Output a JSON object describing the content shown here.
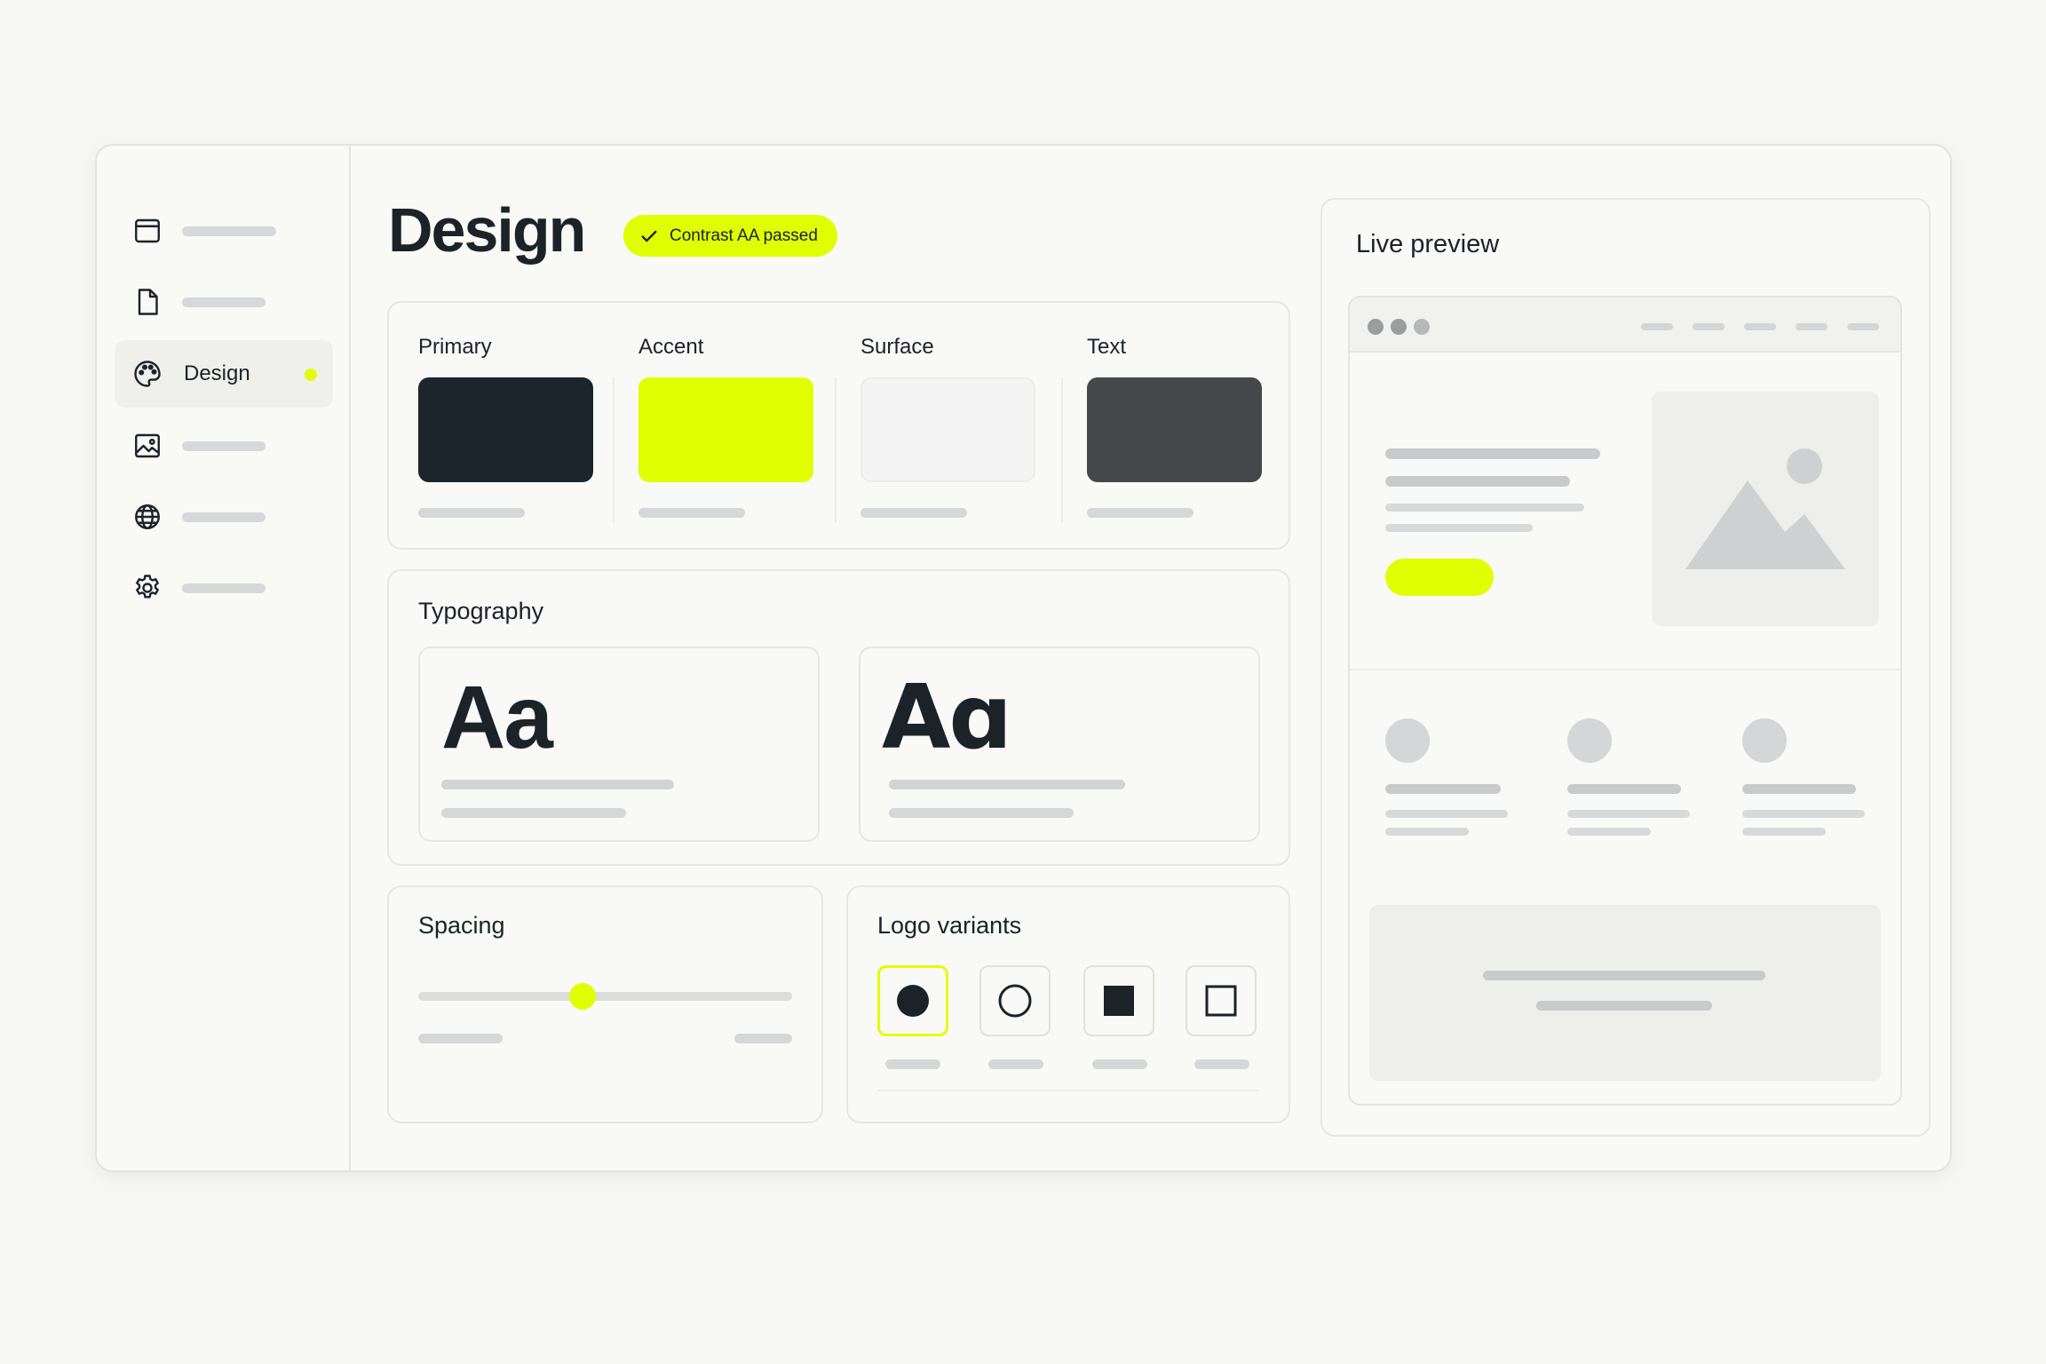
{
  "sidebar": {
    "items": [
      {
        "icon": "window-icon"
      },
      {
        "icon": "document-icon"
      },
      {
        "icon": "palette-icon",
        "label": "Design",
        "active": true
      },
      {
        "icon": "image-icon"
      },
      {
        "icon": "globe-icon"
      },
      {
        "icon": "gear-icon"
      }
    ]
  },
  "header": {
    "title": "Design",
    "badge": "Contrast AA passed"
  },
  "colors": {
    "title": "",
    "swatches": [
      {
        "label": "Primary",
        "color": "#1b252b"
      },
      {
        "label": "Accent",
        "color": "#e0ff00"
      },
      {
        "label": "Surface",
        "color": "#f4f4f4"
      },
      {
        "label": "Text",
        "color": "#46474a"
      }
    ]
  },
  "typography": {
    "title": "Typography",
    "samples": [
      "Aa",
      "Aɑ"
    ]
  },
  "spacing": {
    "title": "Spacing",
    "slider_value": 0.44
  },
  "logos": {
    "title": "Logo variants",
    "variants": [
      "filled-circle-icon",
      "outline-circle-icon",
      "filled-square-icon",
      "outline-square-icon"
    ],
    "selected": 0
  },
  "preview": {
    "title": "Live preview"
  },
  "theme": {
    "accent": "#e0ff00",
    "primary": "#1b2228",
    "background": "#f6f6f2"
  }
}
